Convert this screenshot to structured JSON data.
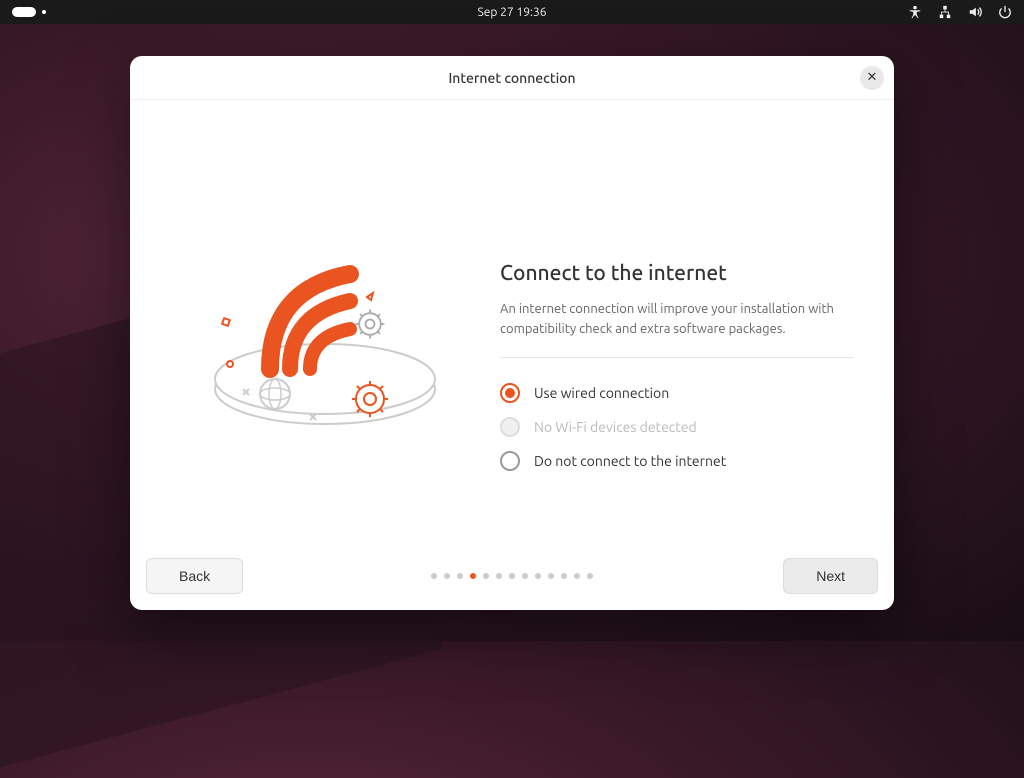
{
  "topbar": {
    "datetime": "Sep 27  19:36"
  },
  "window": {
    "title": "Internet connection"
  },
  "content": {
    "heading": "Connect to the internet",
    "subtitle": "An internet connection will improve your installation with compatibility check and extra software packages.",
    "options": {
      "wired": "Use wired connection",
      "wifi": "No Wi-Fi devices detected",
      "none": "Do not connect to the internet"
    }
  },
  "footer": {
    "back": "Back",
    "next": "Next"
  },
  "progress": {
    "total": 13,
    "current": 4
  },
  "colors": {
    "accent": "#e95420"
  }
}
